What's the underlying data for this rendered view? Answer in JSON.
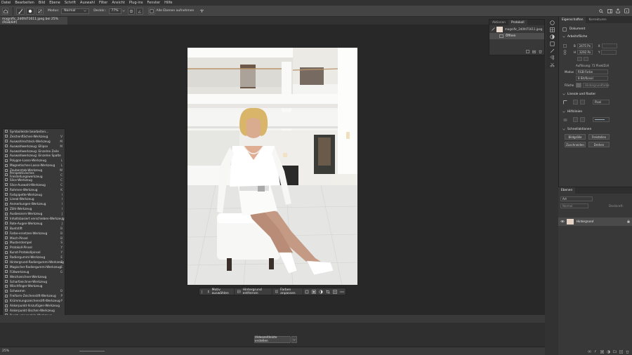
{
  "menubar": {
    "items": [
      "Datei",
      "Bearbeiten",
      "Bild",
      "Ebene",
      "Schrift",
      "Auswahl",
      "Filter",
      "Ansicht",
      "Plug-ins",
      "Fenster",
      "Hilfe"
    ]
  },
  "options_bar": {
    "mode_label": "Modus:",
    "mode_value": "Normal",
    "opacity_label": "Deckkr.:",
    "opacity_value": "77%",
    "all_layers_label": "Alle Ebenen aufnehmen"
  },
  "document": {
    "tab_title": "magnific_2d0fd71611.jpeg bei 25% (RGB/8#)"
  },
  "context_bar": {
    "select_subject": "Motiv auswählen",
    "remove_bg": "Hintergrund entfernen",
    "adjust_colors": "Farben anpassen"
  },
  "tools_menu": {
    "items": [
      {
        "label": "Symbolleiste bearbeiten...",
        "key": ""
      },
      {
        "label": "Zeichenflächen-Werkzeug",
        "key": "V"
      },
      {
        "label": "Auswahlrechteck-Werkzeug",
        "key": "M"
      },
      {
        "label": "Auswahlwerkzeug: Ellipse",
        "key": "M"
      },
      {
        "label": "Auswahlwerkzeug: Einzelne Zeile",
        "key": ""
      },
      {
        "label": "Auswahlwerkzeug: Einzelne Spalte",
        "key": ""
      },
      {
        "label": "Polygon-Lasso-Werkzeug",
        "key": "L"
      },
      {
        "label": "Magnetisches-Lasso-Werkzeug",
        "key": "L"
      },
      {
        "label": "Zauberstab-Werkzeug",
        "key": "W"
      },
      {
        "label": "Perspektivisches Freistellungswerkzeug",
        "key": "C"
      },
      {
        "label": "Slice-Werkzeug",
        "key": "C"
      },
      {
        "label": "Slice-Auswahl-Werkzeug",
        "key": "C"
      },
      {
        "label": "Rahmen-Werkzeug",
        "key": "K"
      },
      {
        "label": "Farbpipette-Werkzeug",
        "key": "I"
      },
      {
        "label": "Lineal-Werkzeug",
        "key": "I"
      },
      {
        "label": "Anmerkungen-Werkzeug",
        "key": "I"
      },
      {
        "label": "Zähl-Werkzeug",
        "key": "I"
      },
      {
        "label": "Ausbessern-Werkzeug",
        "key": "J"
      },
      {
        "label": "Inhaltsbasiert verschieben-Werkzeug",
        "key": "J"
      },
      {
        "label": "Rote-Augen-Werkzeug",
        "key": "J"
      },
      {
        "label": "Buntstift",
        "key": "B"
      },
      {
        "label": "Farbe-ersetzen-Werkzeug",
        "key": "B"
      },
      {
        "label": "Misch-Pinsel",
        "key": "B"
      },
      {
        "label": "Musterstempel",
        "key": "S"
      },
      {
        "label": "Protokoll-Pinsel",
        "key": "Y"
      },
      {
        "label": "Kunst-Protokollpinsel",
        "key": "Y"
      },
      {
        "label": "Radiergummi-Werkzeug",
        "key": "E"
      },
      {
        "label": "Hintergrund-Radiergummi-Werkzeug",
        "key": "E"
      },
      {
        "label": "Magischer-Radiergummi-Werkzeug",
        "key": "E"
      },
      {
        "label": "Füllwerkzeug",
        "key": "G"
      },
      {
        "label": "Weichzeichner-Werkzeug",
        "key": ""
      },
      {
        "label": "Scharfzeichner-Werkzeug",
        "key": ""
      },
      {
        "label": "Wischfinger-Werkzeug",
        "key": ""
      },
      {
        "label": "Schwamm",
        "key": "O"
      },
      {
        "label": "Freiform-Zeichenstift-Werkzeug",
        "key": "P"
      },
      {
        "label": "Krümmungszeichenstift-Werkzeug",
        "key": "P"
      },
      {
        "label": "Ankerpunkt-hinzufügen-Werkzeug",
        "key": ""
      },
      {
        "label": "Ankerpunkt-löschen-Werkzeug",
        "key": ""
      },
      {
        "label": "Punkt-umwandeln-Werkzeug",
        "key": ""
      },
      {
        "label": "Vertikales Text-Werkzeug",
        "key": "T"
      },
      {
        "label": "Vertikales Text-Maskierungswerkzeug",
        "key": "T"
      },
      {
        "label": "Horizontales Text-Maskierungswerkzeug",
        "key": "T"
      },
      {
        "label": "Pfadauswahl-Werkzeug",
        "key": "A"
      },
      {
        "label": "Direktauswahl-Werkzeug",
        "key": "A"
      },
      {
        "label": "Ansichtdrehung-Werkzeug",
        "key": "R"
      }
    ]
  },
  "timeline": {
    "create_video_btn": "Videozeitleiste erstellen"
  },
  "status": {
    "zoom": "25%"
  },
  "history_panel": {
    "tab_actions": "Aktionen",
    "tab_history": "Protokoll",
    "snapshot_name": "magnific_2d0fd71611.jpeg",
    "step_open": "Öffnen"
  },
  "properties_panel": {
    "tab_properties": "Eigenschaften",
    "tab_corrections": "Korrekturen",
    "doc_label": "Dokument",
    "canvas_header": "Arbeitsfläche",
    "width_label": "B",
    "width_value": "2475 Px",
    "height_label": "H",
    "height_value": "3292 Px",
    "x_label": "X",
    "y_label": "Y",
    "resolution": "Auflösung: 72 Pixel/Zoll",
    "mode_label": "Modus",
    "mode_value": "RGB-Farbe",
    "bit_value": "8 Bit/Kanal",
    "fill_label": "Fläche",
    "fill_value": "Hintergrundfarbe",
    "rulers_header": "Lineale und Raster",
    "unit_value": "Pixel",
    "guides_header": "Hilfslinien",
    "quick_actions_header": "Schnellaktionen",
    "btn_crop": "Bildgröße",
    "btn_trim": "Freistellen",
    "btn_image": "Zuschneiden",
    "btn_rotate": "Drehen"
  },
  "layers_panel": {
    "tab_layers": "Ebenen",
    "search_placeholder": "Art",
    "blend_mode": "Normal",
    "opacity_label": "Deckkraft:",
    "layer_name": "Hintergrund"
  }
}
